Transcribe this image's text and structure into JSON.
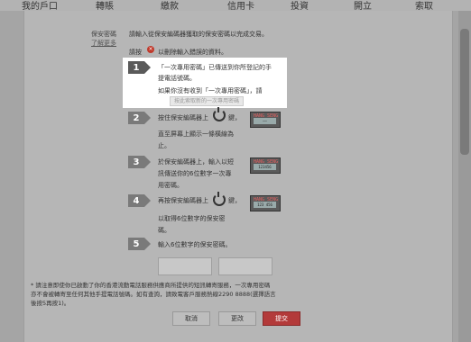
{
  "nav": {
    "items": [
      "我的戶口",
      "轉賬",
      "繳款",
      "信用卡",
      "投資",
      "開立",
      "索取"
    ]
  },
  "form": {
    "security_code_label": "保安密碼",
    "learn_more": "了解更多",
    "intro": "請輸入從保安編碼器獲取的保安密碼以完成交易。",
    "clear_prefix": "請按",
    "clear_suffix": "以刪除輸入錯誤的資料。"
  },
  "steps": [
    {
      "number": "1",
      "lines": [
        "「一次專用密碼」已傳送到你所登記的手",
        "提電話號碼。",
        "如果你沒有收到「一次專用密碼」，請"
      ],
      "resend_label": "按此索取新的一次專用密碼"
    },
    {
      "number": "2",
      "lines": [
        "按住保安編碼器上",
        "鍵，",
        "直至屏幕上顯示一條橫線為",
        "止。"
      ]
    },
    {
      "number": "3",
      "lines": [
        "於保安編碼器上，輸入以短",
        "訊傳送你的6位數字一次專",
        "用密碼。"
      ]
    },
    {
      "number": "4",
      "lines": [
        "再按保安編碼器上",
        "鍵，",
        "以取得6位數字的保安密",
        "碼。"
      ]
    },
    {
      "number": "5",
      "lines": [
        "輸入6位數字的保安密碼。"
      ]
    }
  ],
  "tokens": {
    "brand": "HANG SENG",
    "screen_2": "——",
    "screen_3": "123456",
    "screen_4": "123 456"
  },
  "footnote": {
    "lines": [
      "* 請注意即使你已啟動了你的香港流動電話服務供應商所提供的短訊轉寄服務，一次專用密碼",
      "亦不會被轉寄至任何其他手提電話號碼。如有查詢，請致電客戶服務熱線2290 8888(選擇語言",
      "後按5再按1)。"
    ]
  },
  "buttons": {
    "cancel": "取消",
    "modify": "更改",
    "submit": "提交"
  },
  "colors": {
    "submit_button": "#b33a3a",
    "clear_icon": "#c0392b"
  }
}
